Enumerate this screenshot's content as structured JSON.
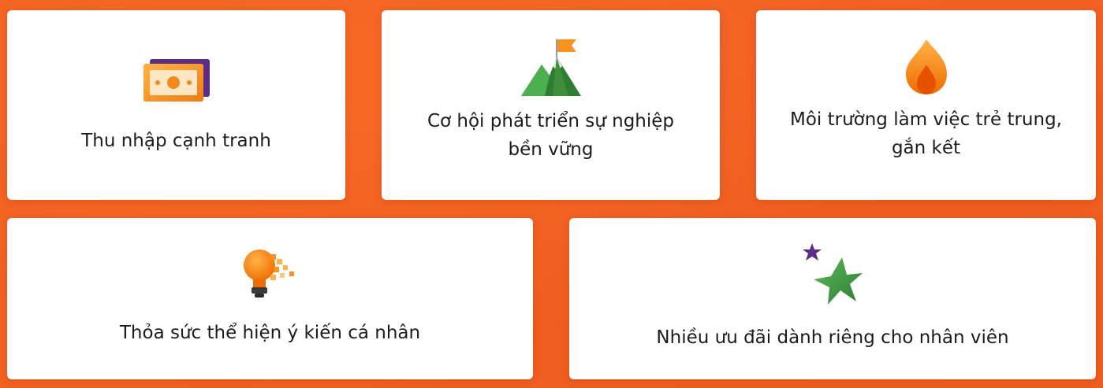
{
  "benefits": [
    {
      "label": "Thu nhập cạnh tranh",
      "icon": "money-icon"
    },
    {
      "label": "Cơ hội phát triển sự nghiệp bền vững",
      "icon": "mountain-flag-icon"
    },
    {
      "label": "Môi trường làm việc trẻ trung, gắn kết",
      "icon": "flame-icon"
    },
    {
      "label": "Thỏa sức thể hiện ý kiến cá nhân",
      "icon": "lightbulb-icon"
    },
    {
      "label": "Nhiều ưu đãi dành riêng cho nhân viên",
      "icon": "stars-icon"
    }
  ],
  "colors": {
    "background": "#f26122",
    "card": "#ffffff",
    "text": "#1c1c1c",
    "accent_orange": "#f7931e",
    "accent_green": "#3e8e3a",
    "accent_purple": "#5b2d86"
  }
}
